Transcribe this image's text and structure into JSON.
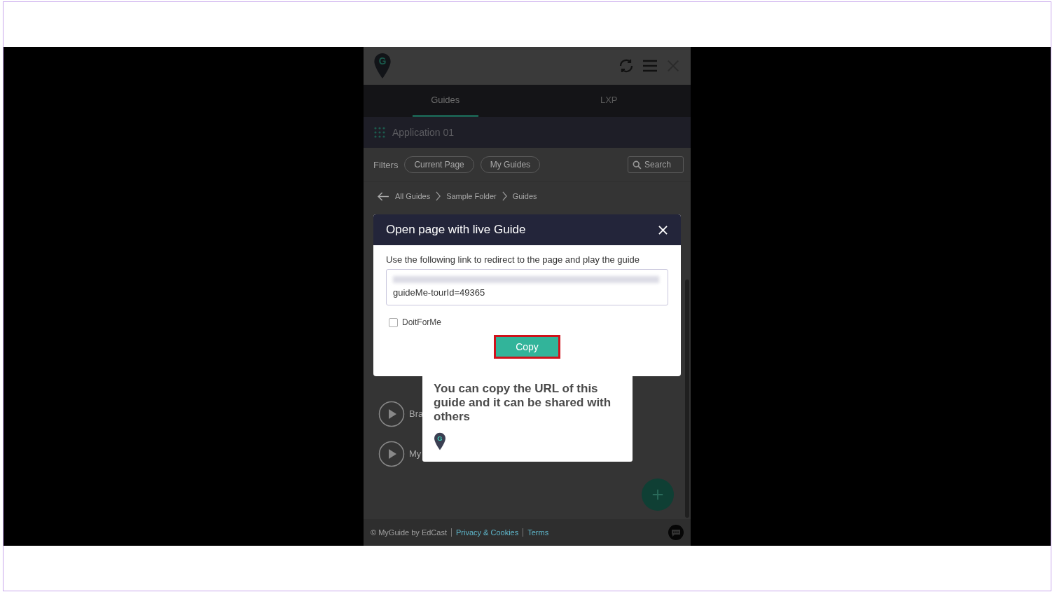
{
  "header": {
    "logo_letter": "G"
  },
  "tabs": [
    {
      "label": "Guides",
      "selected": true
    },
    {
      "label": "LXP",
      "selected": false
    }
  ],
  "app_bar": {
    "name": "Application 01"
  },
  "filters": {
    "label": "Filters",
    "chips": [
      "Current Page",
      "My Guides"
    ],
    "search": {
      "placeholder": "Search"
    }
  },
  "breadcrumb": [
    "All Guides",
    "Sample Folder",
    "Guides"
  ],
  "guides": [
    {
      "title": "Bra"
    },
    {
      "title": "My"
    }
  ],
  "footer": {
    "copyright": "© MyGuide by EdCast",
    "links": [
      "Privacy & Cookies",
      "Terms"
    ]
  },
  "dialog": {
    "title": "Open page with live Guide",
    "description": "Use the following link to redirect to the page and play the guide",
    "link_value": "guideMe-tourId=49365",
    "options": [
      {
        "label": "DoitForMe",
        "checked": false
      }
    ],
    "button": "Copy"
  },
  "tooltip": {
    "text": "You can copy the URL of this guide and it can be shared with others",
    "logo_letter": "G"
  }
}
